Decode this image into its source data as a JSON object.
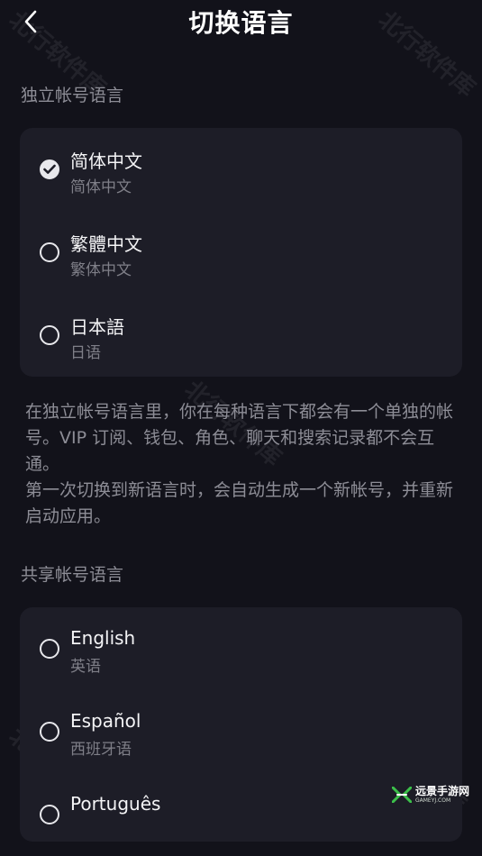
{
  "header": {
    "title": "切换语言",
    "back_icon": "chevron-left-icon"
  },
  "independent": {
    "header": "独立帐号语言",
    "options": [
      {
        "label": "简体中文",
        "sublabel": "简体中文",
        "selected": true
      },
      {
        "label": "繁體中文",
        "sublabel": "繁体中文",
        "selected": false
      },
      {
        "label": "日本語",
        "sublabel": "日语",
        "selected": false
      }
    ],
    "note_line1": "在独立帐号语言里，你在每种语言下都会有一个单独的帐号。VIP 订阅、钱包、角色、聊天和搜索记录都不会互通。",
    "note_line2": "第一次切换到新语言时，会自动生成一个新帐号，并重新启动应用。"
  },
  "shared": {
    "header": "共享帐号语言",
    "options": [
      {
        "label": "English",
        "sublabel": "英语",
        "selected": false
      },
      {
        "label": "Español",
        "sublabel": "西班牙语",
        "selected": false
      },
      {
        "label": "Português",
        "sublabel": "",
        "selected": false
      }
    ]
  },
  "watermark": "北行软件库",
  "corner_logo": {
    "main": "远景手游网",
    "sub": "GAMEYJ.COM"
  },
  "colors": {
    "background": "#12121a",
    "card": "#1d1d27",
    "secondary_text": "#8d8d96",
    "logo_green": "#3cc04a"
  }
}
